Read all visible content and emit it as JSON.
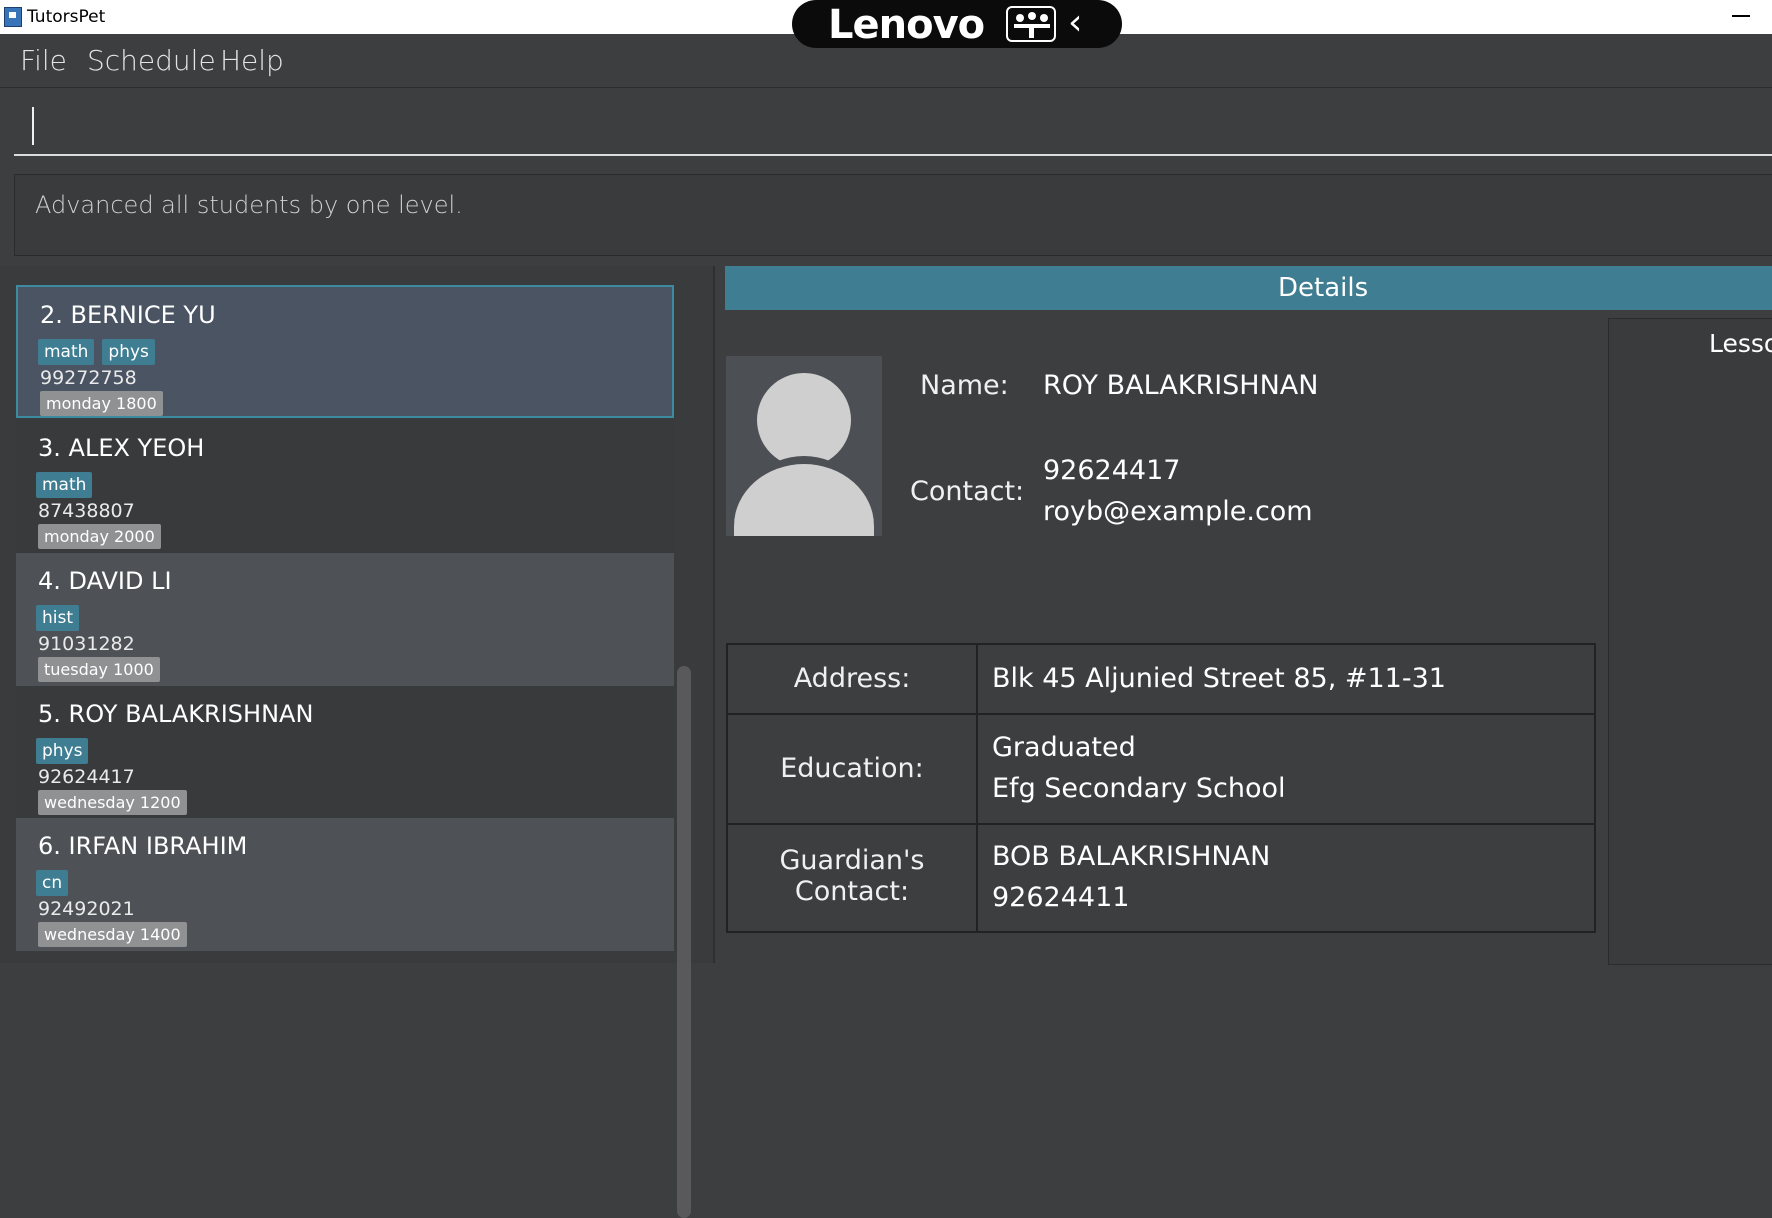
{
  "window": {
    "title": "TutorsPet"
  },
  "overlay": {
    "brand": "Lenovo"
  },
  "menu": {
    "items": [
      "File",
      "Schedule",
      "Help"
    ]
  },
  "result": {
    "message": "Advanced all students by one level."
  },
  "students": [
    {
      "name": "2.  BERNICE YU",
      "tags": [
        "math",
        "phys"
      ],
      "phone": "99272758",
      "slot": "monday 1800"
    },
    {
      "name": "3.  ALEX YEOH",
      "tags": [
        "math"
      ],
      "phone": "87438807",
      "slot": "monday 2000"
    },
    {
      "name": "4.  DAVID LI",
      "tags": [
        "hist"
      ],
      "phone": "91031282",
      "slot": "tuesday 1000"
    },
    {
      "name": "5.  ROY BALAKRISHNAN",
      "tags": [
        "phys"
      ],
      "phone": "92624417",
      "slot": "wednesday 1200"
    },
    {
      "name": "6.  IRFAN IBRAHIM",
      "tags": [
        "cn"
      ],
      "phone": "92492021",
      "slot": "wednesday 1400"
    }
  ],
  "details": {
    "header": "Details",
    "name_label": "Name:",
    "name_value": "ROY BALAKRISHNAN",
    "contact_label": "Contact:",
    "contact_phone": "92624417",
    "contact_email": "royb@example.com",
    "address_label": "Address:",
    "address_value": "Blk 45 Aljunied Street 85, #11-31",
    "education_label": "Education:",
    "education_line1": "Graduated",
    "education_line2": "Efg Secondary School",
    "guardian_label_1": "Guardian's",
    "guardian_label_2": "Contact:",
    "guardian_name": "BOB BALAKRISHNAN",
    "guardian_phone": "92624411"
  },
  "lessons": {
    "title": "Lesso"
  }
}
